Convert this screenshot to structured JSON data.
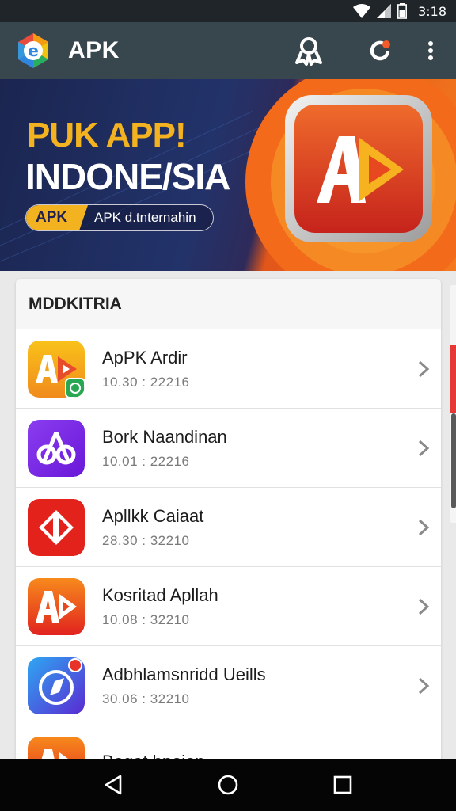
{
  "status_bar": {
    "time": "3:18"
  },
  "app_bar": {
    "title": "APK",
    "logo_letter": "e"
  },
  "banner": {
    "headline": "PUK APP!",
    "title": "INDONE/SIA",
    "pill_tag": "APK",
    "pill_text": "APK d.tnternahin",
    "logo_text": "AD"
  },
  "list": {
    "header": "MDDKITRIA",
    "items": [
      {
        "name": "ApPK Ardir",
        "meta": "10.30 : 22216",
        "icon": "ad-yellow-icon",
        "badge": true
      },
      {
        "name": "Bork Naandinan",
        "meta": "10.01 : 22216",
        "icon": "ab-purple-icon"
      },
      {
        "name": "Apllkk Caiaat",
        "meta": "28.30 : 32210",
        "icon": "diamond-red-icon"
      },
      {
        "name": "Kosritad Apllah",
        "meta": "10.08 : 32210",
        "icon": "ad-orange-icon"
      },
      {
        "name": "Adbhlamsnridd Ueills",
        "meta": "30.06 : 32210",
        "icon": "compass-blue-icon"
      },
      {
        "name": "Bogat bnoion",
        "meta": "",
        "icon": "ab-orange-icon"
      }
    ]
  },
  "colors": {
    "status_bar": "#1f2528",
    "app_bar": "#38464d",
    "banner_navy": "#1b2550",
    "banner_orange": "#f47a1e",
    "accent_yellow": "#f3b21f"
  }
}
